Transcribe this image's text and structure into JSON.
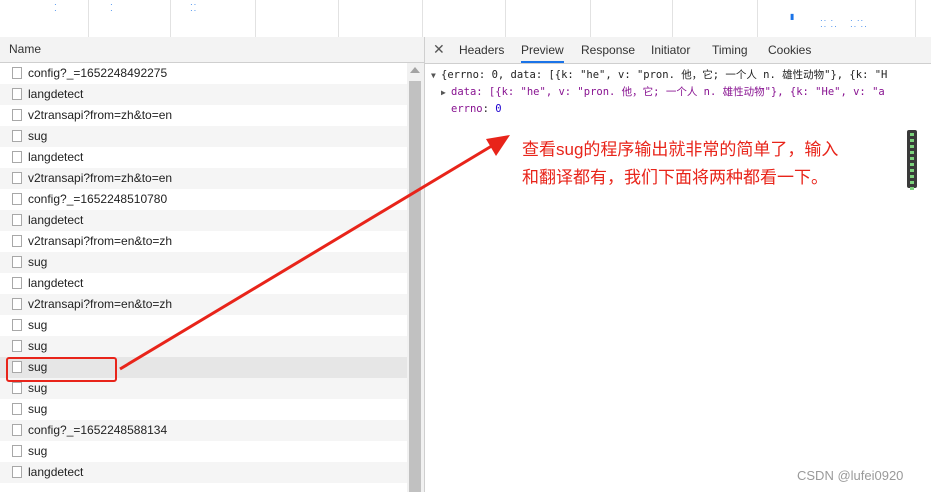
{
  "devtools": {
    "network_list": {
      "header": "Name",
      "rows": [
        "config?_=1652248492275",
        "langdetect",
        "v2transapi?from=zh&to=en",
        "sug",
        "langdetect",
        "v2transapi?from=zh&to=en",
        "config?_=1652248510780",
        "langdetect",
        "v2transapi?from=en&to=zh",
        "sug",
        "langdetect",
        "v2transapi?from=en&to=zh",
        "sug",
        "sug",
        "sug",
        "sug",
        "sug",
        "config?_=1652248588134",
        "sug",
        "langdetect"
      ],
      "selected_index": 14
    },
    "detail_tabs": [
      "Headers",
      "Preview",
      "Response",
      "Initiator",
      "Timing",
      "Cookies"
    ],
    "active_tab": "Preview",
    "preview": {
      "line1": "{errno: 0, data: [{k: \"he\", v: \"pron. 他，它; 一个人 n. 雄性动物\"}, {k: \"H",
      "line2": "data: [{k: \"he\", v: \"pron. 他，它; 一个人 n. 雄性动物\"}, {k: \"He\", v: \"a",
      "line3_key": "errno",
      "line3_value": "0"
    }
  },
  "annotation": {
    "line1": "查看sug的程序输出就非常的简单了，输入",
    "line2": "和翻译都有，我们下面将两种都看一下。"
  },
  "watermark": "CSDN @lufei0920",
  "colors": {
    "annotation": "#e8241a",
    "tab_active": "#1a73e8"
  }
}
